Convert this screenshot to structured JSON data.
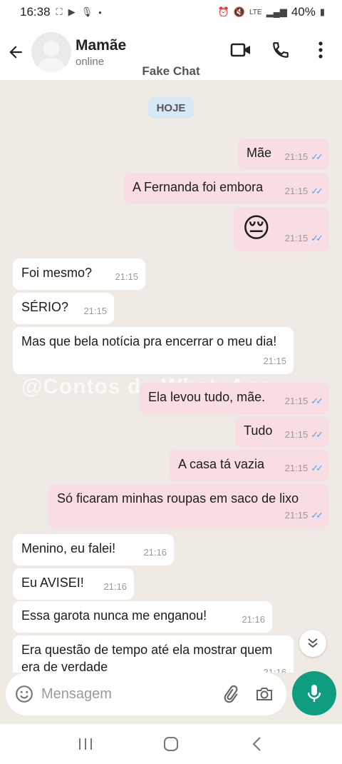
{
  "status": {
    "time": "16:38",
    "battery": "40%",
    "network": "LTE"
  },
  "header": {
    "contact_name": "Mamãe",
    "contact_status": "online"
  },
  "app_title": "Fake Chat",
  "date_chip": "HOJE",
  "watermark": "@Contos do WhatsApp",
  "messages": [
    {
      "dir": "out",
      "text": "Mãe",
      "time": "21:15"
    },
    {
      "dir": "out",
      "text": "A Fernanda foi embora",
      "time": "21:15"
    },
    {
      "dir": "out",
      "text": "😔",
      "time": "21:15",
      "emoji": true
    },
    {
      "dir": "in",
      "text": "Foi mesmo?",
      "time": "21:15"
    },
    {
      "dir": "in",
      "text": "SÉRIO?",
      "time": "21:15"
    },
    {
      "dir": "in",
      "text": "Mas que bela notícia pra encerrar o meu dia!",
      "time": "21:15"
    },
    {
      "dir": "out",
      "text": "Ela levou tudo, mãe.",
      "time": "21:15"
    },
    {
      "dir": "out",
      "text": "Tudo",
      "time": "21:15"
    },
    {
      "dir": "out",
      "text": "A casa tá vazia",
      "time": "21:15"
    },
    {
      "dir": "out",
      "text": "Só ficaram minhas roupas em saco de lixo",
      "time": "21:15"
    },
    {
      "dir": "in",
      "text": "Menino, eu falei!",
      "time": "21:16"
    },
    {
      "dir": "in",
      "text": "Eu AVISEI!",
      "time": "21:16"
    },
    {
      "dir": "in",
      "text": "Essa garota nunca me enganou!",
      "time": "21:16"
    },
    {
      "dir": "in",
      "text": "Era questão de tempo até ela mostrar quem era de verdade",
      "time": "21:16"
    }
  ],
  "composer": {
    "placeholder": "Mensagem"
  },
  "colors": {
    "outgoing_bubble": "#f8dde2",
    "incoming_bubble": "#ffffff",
    "chat_bg": "#efeae4",
    "accent": "#0f9d82",
    "read_ticks": "#53a6e8"
  },
  "icons": [
    "back-arrow-icon",
    "video-call-icon",
    "phone-icon",
    "more-vert-icon",
    "emoji-icon",
    "attach-icon",
    "camera-icon",
    "mic-icon",
    "scroll-down-icon"
  ]
}
